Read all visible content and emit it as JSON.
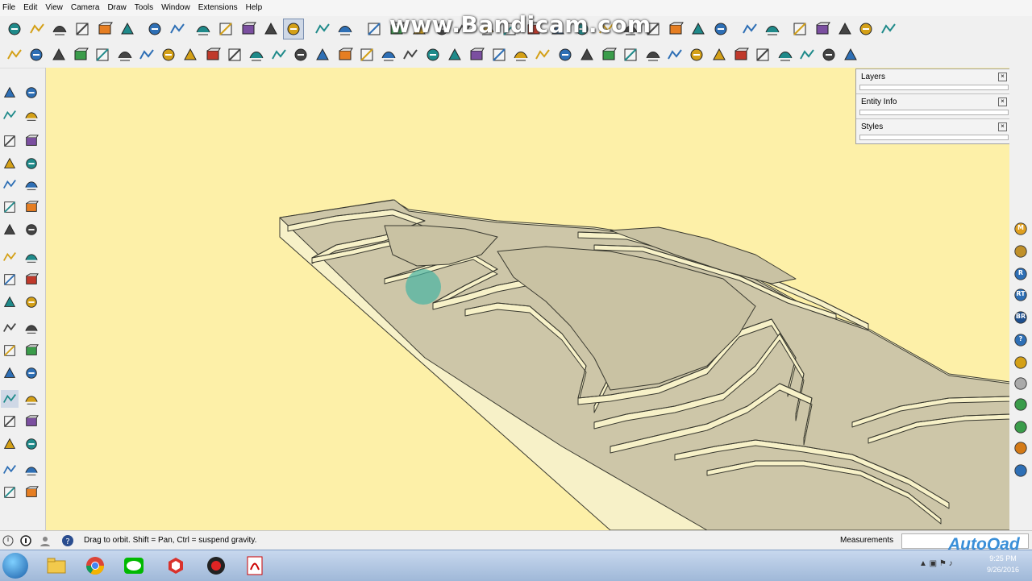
{
  "menubar": {
    "items": [
      "File",
      "Edit",
      "View",
      "Camera",
      "Draw",
      "Tools",
      "Window",
      "Extensions",
      "Help"
    ]
  },
  "watermark": {
    "text": "www.Bandicam.com"
  },
  "tray": {
    "panels": [
      {
        "title": "Layers"
      },
      {
        "title": "Entity Info"
      },
      {
        "title": "Styles"
      }
    ],
    "close_glyph": "×"
  },
  "status": {
    "message": "Drag to orbit. Shift = Pan, Ctrl = suspend gravity.",
    "measurements_label": "Measurements",
    "brand": "AutoQad"
  },
  "taskbar": {
    "time": "9:25 PM",
    "date": "9/26/2016",
    "apps": [
      "windows-explorer",
      "chrome",
      "line",
      "sketchup",
      "bandicam",
      "acrobat-reader"
    ]
  },
  "right_toolbar": {
    "labels": [
      "M",
      "",
      "R",
      "RT",
      "BR",
      "?",
      "",
      "",
      "",
      "",
      "",
      ""
    ]
  },
  "colors": {
    "viewport_bg": "#fdf0a8",
    "terrain_top": "#cdc6a8",
    "terrain_side": "#f7f1c8",
    "terrain_edge": "#3a3a30",
    "orbit_cursor": "#47b3a2"
  }
}
